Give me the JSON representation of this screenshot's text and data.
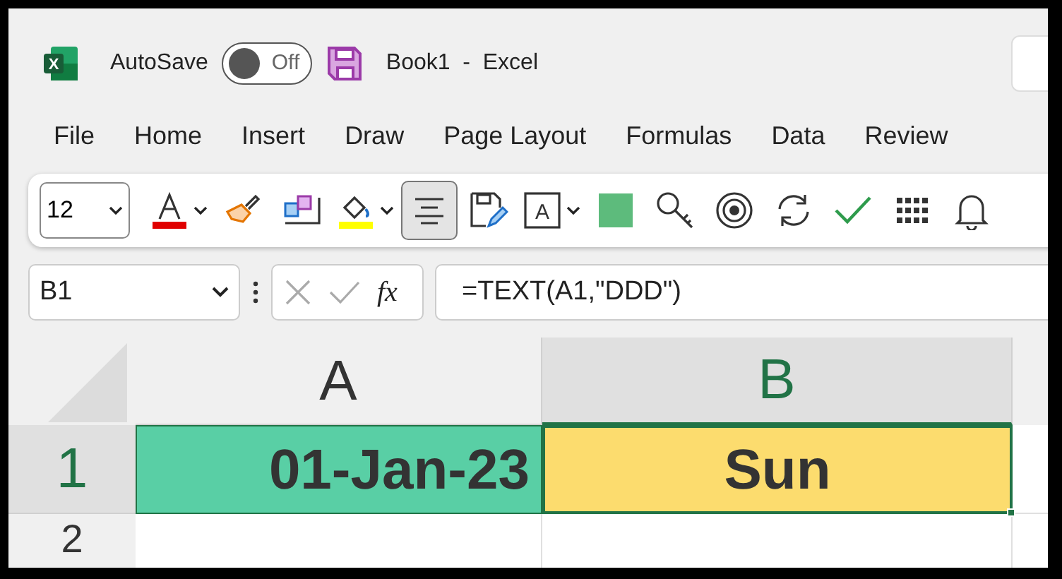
{
  "title_bar": {
    "app_icon_letter": "X",
    "autosave_label": "AutoSave",
    "autosave_toggle": {
      "on": false,
      "label": "Off"
    },
    "document": "Book1",
    "separator": "-",
    "app": "Excel"
  },
  "menu": [
    {
      "label": "File"
    },
    {
      "label": "Home"
    },
    {
      "label": "Insert"
    },
    {
      "label": "Draw"
    },
    {
      "label": "Page Layout"
    },
    {
      "label": "Formulas"
    },
    {
      "label": "Data"
    },
    {
      "label": "Review"
    }
  ],
  "toolbar": {
    "font_size": "12",
    "tools": [
      {
        "kind": "font-color",
        "pressed": false,
        "dropdown": true,
        "color": "#e00000"
      },
      {
        "kind": "format-painter",
        "pressed": false
      },
      {
        "kind": "cubes",
        "pressed": false
      },
      {
        "kind": "fill-color",
        "pressed": false,
        "dropdown": true,
        "color": "#ffff00"
      },
      {
        "kind": "align-center",
        "pressed": true
      },
      {
        "kind": "save-edit",
        "pressed": false
      },
      {
        "kind": "text-box",
        "pressed": false,
        "dropdown": true,
        "letter": "A"
      },
      {
        "kind": "square",
        "pressed": false,
        "color": "#5dbb7c"
      },
      {
        "kind": "key",
        "pressed": false
      },
      {
        "kind": "target",
        "pressed": false
      },
      {
        "kind": "refresh",
        "pressed": false
      },
      {
        "kind": "check",
        "pressed": false
      },
      {
        "kind": "grid",
        "pressed": false
      },
      {
        "kind": "bell",
        "pressed": false
      }
    ]
  },
  "formula_bar": {
    "name_box": "B1",
    "fx": "fx",
    "formula": "=TEXT(A1,\"DDD\")"
  },
  "sheet": {
    "columns": [
      {
        "label": "A",
        "selected": false
      },
      {
        "label": "B",
        "selected": true
      }
    ],
    "rows": [
      {
        "label": "1",
        "selected": true,
        "cells": [
          {
            "value": "01-Jan-23",
            "color": "#59cfa5",
            "selected": false
          },
          {
            "value": "Sun",
            "color": "#fcdc6e",
            "selected": true
          }
        ]
      },
      {
        "label": "2",
        "selected": false,
        "cells": []
      }
    ]
  }
}
